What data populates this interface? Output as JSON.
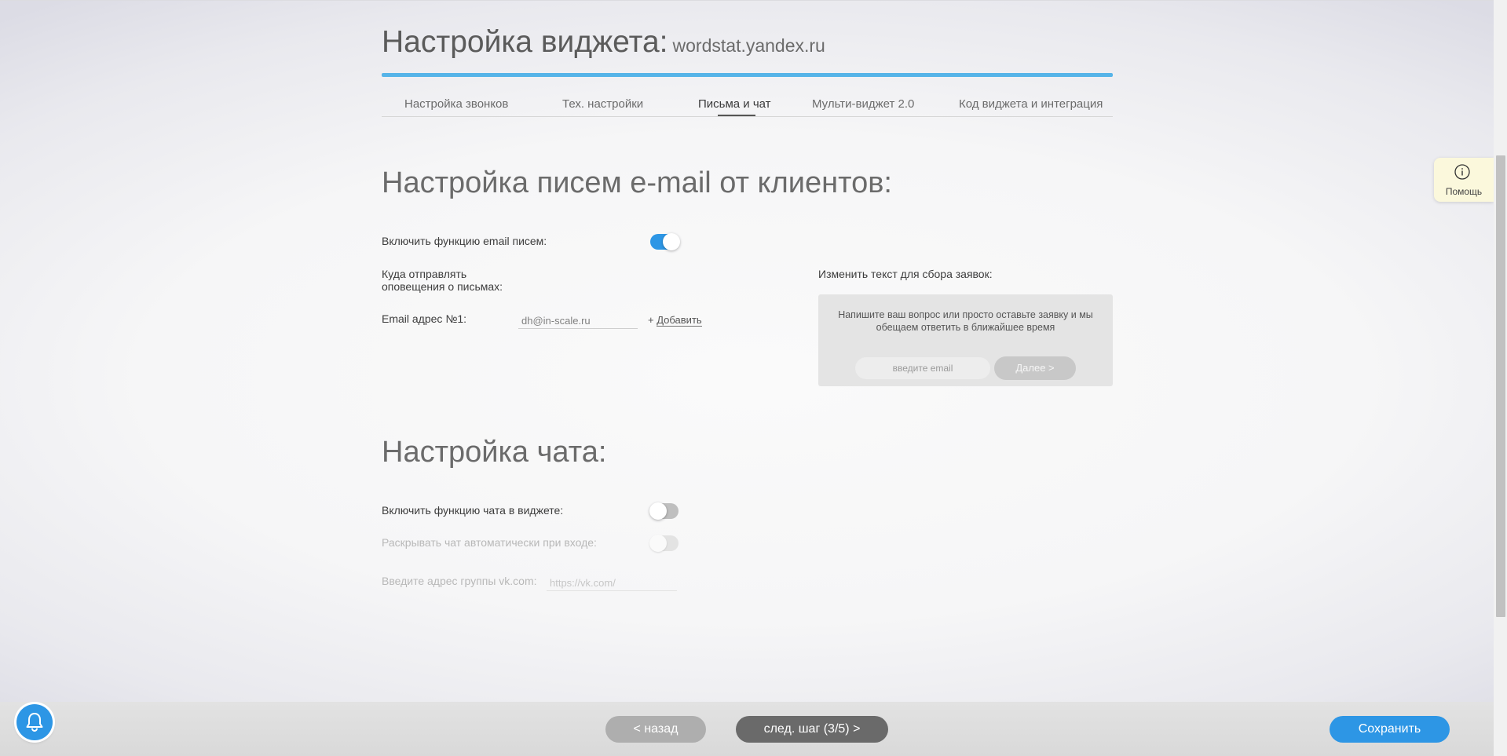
{
  "header": {
    "title": "Настройка виджета:",
    "site": "wordstat.yandex.ru"
  },
  "tabs": [
    {
      "label": "Настройка звонков",
      "active": false
    },
    {
      "label": "Тех. настройки",
      "active": false
    },
    {
      "label": "Письма и чат",
      "active": true
    },
    {
      "label": "Мульти-виджет 2.0",
      "active": false
    },
    {
      "label": "Код виджета и интеграция",
      "active": false
    }
  ],
  "email_section": {
    "title": "Настройка писем e-mail от клиентов:",
    "enable_label": "Включить функцию email писем:",
    "enable_on": true,
    "send_to_label_1": "Куда отправлять",
    "send_to_label_2": "оповещения о письмах:",
    "email_label": "Email адрес №1:",
    "email_value": "dh@in-scale.ru",
    "add_prefix": "+",
    "add_label": "Добавить",
    "change_text_label": "Изменить текст для сбора заявок:",
    "preview": {
      "text": "Напишите ваш вопрос или просто оставьте заявку и мы обещаем ответить в ближайшее время",
      "input_placeholder": "введите email",
      "button_label": "Далее >"
    }
  },
  "chat_section": {
    "title": "Настройка чата:",
    "enable_label": "Включить функцию чата в виджете:",
    "enable_on": false,
    "auto_open_label": "Раскрывать чат автоматически при входе:",
    "auto_open_on": false,
    "vk_label": "Введите адрес группы vk.com:",
    "vk_placeholder": "https://vk.com/"
  },
  "help": {
    "label": "Помощь",
    "icon": "info-icon"
  },
  "footer": {
    "back_label": "< назад",
    "next_label": "след. шаг (3/5) >",
    "save_label": "Сохранить",
    "bell_icon": "bell-icon"
  },
  "colors": {
    "accent": "#2d96e5",
    "progress_bar": "#56b4e8",
    "help_bg": "#fbf8dc"
  }
}
